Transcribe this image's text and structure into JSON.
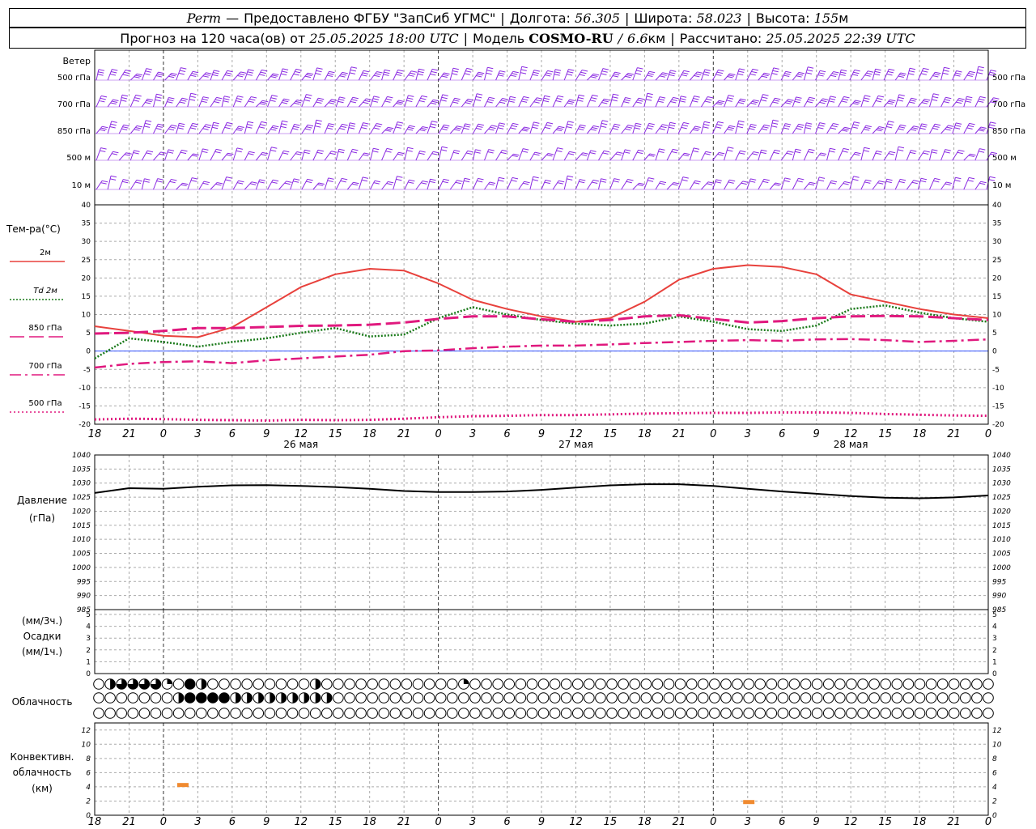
{
  "header": {
    "station": "Perm",
    "dash": "—",
    "provider": "Предоставлено ФГБУ \"ЗапСиб УГМС\"",
    "lon_label": "Долгота:",
    "lon": "56.305",
    "lat_label": "Широта:",
    "lat": "58.023",
    "alt_label": "Высота:",
    "alt": "155",
    "alt_unit": "м",
    "fc_label": "Прогноз на 120 часа(ов) от",
    "fc_time": "25.05.2025 18:00 UTC",
    "model_label": "Модель",
    "model": "COSMO-RU",
    "res": "6.6",
    "res_unit": "км",
    "calc_label": "Рассчитано:",
    "calc_time": "25.05.2025 22:39 UTC"
  },
  "wind_panel": {
    "title": "Ветер",
    "levels": [
      "500 гПа",
      "700 гПа",
      "850 гПа",
      "500 м",
      "10 м"
    ],
    "color": "#8b2be2"
  },
  "time_axis": {
    "ticks": [
      "18",
      "21",
      "0",
      "3",
      "6",
      "9",
      "12",
      "15",
      "18",
      "21",
      "0",
      "3",
      "6",
      "9",
      "12",
      "15",
      "18",
      "21",
      "0",
      "3",
      "6",
      "9",
      "12",
      "15",
      "18",
      "21",
      "0"
    ],
    "days": [
      {
        "label": "26 мая",
        "tick_index": 6
      },
      {
        "label": "27 мая",
        "tick_index": 14
      },
      {
        "label": "28 мая",
        "tick_index": 22
      }
    ]
  },
  "chart_data": [
    {
      "type": "line",
      "id": "temperature",
      "title": "Тем-ра(°C)",
      "ylim": [
        -20,
        40
      ],
      "yticks": [
        "40",
        "35",
        "30",
        "25",
        "20",
        "15",
        "10",
        "5",
        "0",
        "-5",
        "-10",
        "-15",
        "-20"
      ],
      "x_hours": [
        0,
        3,
        6,
        9,
        12,
        15,
        18,
        21,
        24,
        27,
        30,
        33,
        36,
        39,
        42,
        45,
        48,
        51,
        54,
        57,
        60,
        63,
        66,
        69,
        72,
        75,
        78
      ],
      "series": [
        {
          "name": "2м",
          "color": "#e8413c",
          "style": "solid",
          "values": [
            6.8,
            5.5,
            4.2,
            3.8,
            6.5,
            12,
            17.5,
            21,
            22.5,
            22,
            18.5,
            14,
            11.5,
            9.5,
            8,
            9,
            13.5,
            19.5,
            22.5,
            23.5,
            23,
            21,
            15.5,
            13.5,
            11.5,
            10,
            9
          ]
        },
        {
          "name": "Td 2м",
          "color": "#1a7a1a",
          "style": "dotted",
          "values": [
            -2,
            3.5,
            2.5,
            1.2,
            2.5,
            3.5,
            5,
            6.3,
            4,
            4.5,
            9,
            12,
            10,
            8.5,
            7.5,
            7,
            7.5,
            9.5,
            8,
            6,
            5.5,
            7,
            11.5,
            12.5,
            10.5,
            9,
            8
          ]
        },
        {
          "name": "850 гПа",
          "color": "#e0197e",
          "style": "dash",
          "values": [
            4.8,
            5,
            5.5,
            6.3,
            6.3,
            6.6,
            6.9,
            7,
            7.2,
            7.8,
            8.8,
            9.5,
            9.5,
            8.7,
            8,
            8.5,
            9.5,
            9.8,
            8.8,
            7.8,
            8.2,
            9,
            9.5,
            9.6,
            9.5,
            9,
            8.5
          ]
        },
        {
          "name": "700 гПа",
          "color": "#e0197e",
          "style": "dashdot",
          "values": [
            -4.5,
            -3.5,
            -3,
            -2.8,
            -3.3,
            -2.5,
            -2,
            -1.5,
            -1,
            0,
            0.2,
            0.8,
            1.2,
            1.5,
            1.5,
            1.8,
            2.2,
            2.5,
            2.8,
            3,
            2.8,
            3.2,
            3.3,
            3,
            2.5,
            2.8,
            3.2
          ]
        },
        {
          "name": "500 гПа",
          "color": "#e0197e",
          "style": "fine",
          "values": [
            -18.7,
            -18.5,
            -18.6,
            -18.8,
            -18.9,
            -19,
            -18.8,
            -18.9,
            -18.8,
            -18.5,
            -18.1,
            -17.8,
            -17.7,
            -17.5,
            -17.5,
            -17.3,
            -17.1,
            -17,
            -16.9,
            -16.9,
            -16.8,
            -16.8,
            -16.9,
            -17.2,
            -17.4,
            -17.6,
            -17.7
          ]
        }
      ]
    },
    {
      "type": "line",
      "id": "pressure",
      "title": "Давление",
      "unit": "(гПа)",
      "ylim": [
        985,
        1040
      ],
      "yticks": [
        "1040",
        "1035",
        "1030",
        "1025",
        "1020",
        "1015",
        "1010",
        "1005",
        "1000",
        "995",
        "990",
        "985"
      ],
      "x_hours": [
        0,
        3,
        6,
        9,
        12,
        15,
        18,
        21,
        24,
        27,
        30,
        33,
        36,
        39,
        42,
        45,
        48,
        51,
        54,
        57,
        60,
        63,
        66,
        69,
        72,
        75,
        78
      ],
      "series": [
        {
          "name": "давление",
          "color": "#000000",
          "values": [
            1026.5,
            1028.2,
            1028,
            1028.7,
            1029.2,
            1029.3,
            1029,
            1028.6,
            1028,
            1027.2,
            1026.8,
            1026.8,
            1027,
            1027.6,
            1028.4,
            1029.2,
            1029.6,
            1029.6,
            1029,
            1028,
            1027,
            1026.2,
            1025.4,
            1024.8,
            1024.6,
            1024.9,
            1025.6
          ]
        }
      ]
    },
    {
      "type": "bar",
      "id": "precipitation",
      "title_top": "(мм/3ч.)",
      "title": "Осадки",
      "title_bottom": "(мм/1ч.)",
      "ylim": [
        0,
        5
      ],
      "yticks": [
        "5",
        "4",
        "3",
        "2",
        "1",
        "0"
      ],
      "values": []
    },
    {
      "type": "table",
      "id": "cloudiness",
      "title": "Облачность",
      "rows": [
        [
          0,
          2,
          3,
          3,
          3,
          3,
          1,
          0,
          4,
          2,
          0,
          0,
          0,
          0,
          0,
          0,
          0,
          0,
          0,
          2,
          0,
          0,
          0,
          0,
          0,
          0,
          0,
          0,
          0,
          0,
          0,
          0,
          1,
          0,
          0,
          0,
          0,
          0,
          0,
          0,
          0,
          0,
          0,
          0,
          0,
          0,
          0,
          0,
          0,
          0,
          0,
          0,
          0,
          0,
          0,
          0,
          0,
          0,
          0,
          0,
          0,
          0,
          0,
          0,
          0,
          0,
          0,
          0,
          0,
          0,
          0,
          0,
          0,
          0,
          0,
          0,
          0,
          0,
          0
        ],
        [
          0,
          0,
          0,
          0,
          0,
          0,
          0,
          2,
          4,
          4,
          4,
          4,
          2,
          2,
          2,
          2,
          2,
          2,
          2,
          2,
          2,
          0,
          0,
          0,
          0,
          0,
          0,
          0,
          0,
          0,
          0,
          0,
          0,
          0,
          0,
          0,
          0,
          0,
          0,
          0,
          0,
          0,
          0,
          0,
          0,
          0,
          0,
          0,
          0,
          0,
          0,
          0,
          0,
          0,
          0,
          0,
          0,
          0,
          0,
          0,
          0,
          0,
          0,
          0,
          0,
          0,
          0,
          0,
          0,
          0,
          0,
          0,
          0,
          0,
          0,
          0,
          0,
          0,
          0
        ],
        [
          0,
          0,
          0,
          0,
          0,
          0,
          0,
          0,
          0,
          0,
          0,
          0,
          0,
          0,
          0,
          0,
          0,
          0,
          0,
          0,
          0,
          0,
          0,
          0,
          0,
          0,
          0,
          0,
          0,
          0,
          0,
          0,
          0,
          0,
          0,
          0,
          0,
          0,
          0,
          0,
          0,
          0,
          0,
          0,
          0,
          0,
          0,
          0,
          0,
          0,
          0,
          0,
          0,
          0,
          0,
          0,
          0,
          0,
          0,
          0,
          0,
          0,
          0,
          0,
          0,
          0,
          0,
          0,
          0,
          0,
          0,
          0,
          0,
          0,
          0,
          0,
          0,
          0,
          0
        ]
      ]
    },
    {
      "type": "bar",
      "id": "convective",
      "title": "Конвективн.",
      "title2": "облачность",
      "unit": "(км)",
      "ylim": [
        0,
        13
      ],
      "yticks": [
        "12",
        "10",
        "8",
        "6",
        "4",
        "2",
        "0"
      ],
      "bars": [
        {
          "x_hour": 7.7,
          "value": 4.2
        },
        {
          "x_hour": 57.1,
          "value": 1.8
        }
      ],
      "color": "#f08a30"
    }
  ]
}
